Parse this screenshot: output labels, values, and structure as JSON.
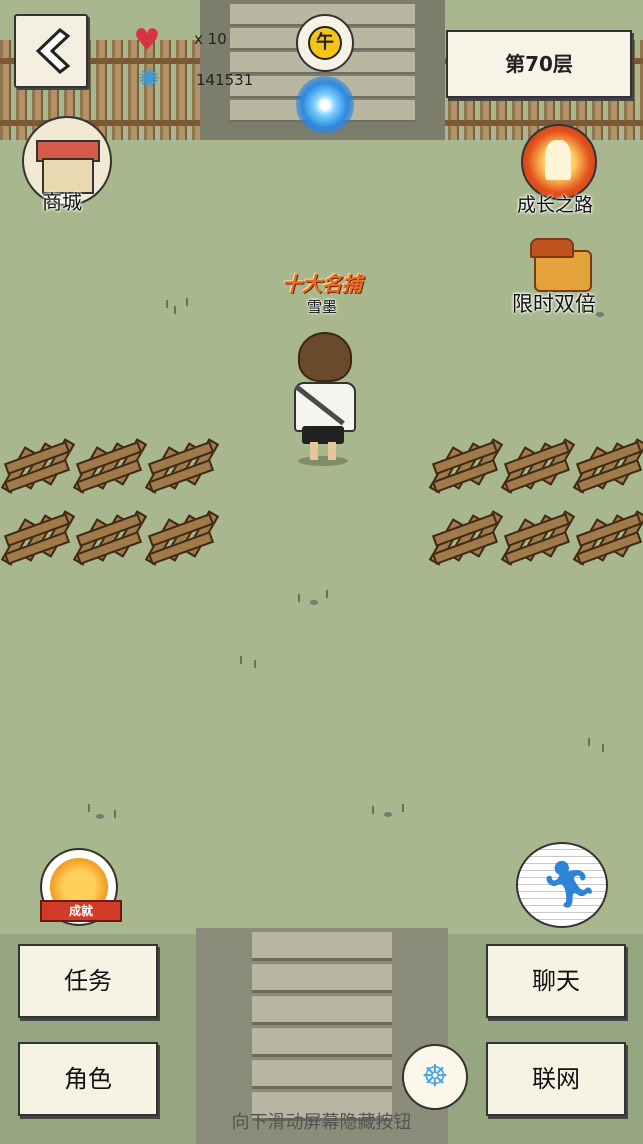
{
  "hud": {
    "lives": "x 10",
    "stamina": "141531",
    "time_glyph": "午",
    "floor": "第70层"
  },
  "icons": {
    "back": "chevron-left-icon",
    "heart": "heart-icon",
    "stamina": "swirl-icon",
    "time": "sun-icon",
    "portal": "portal-icon"
  },
  "features": {
    "shop": "商城",
    "growth": "成长之路",
    "double": "限时双倍",
    "achievement": "成就"
  },
  "player": {
    "title": "十大名捕",
    "name": "雪墨"
  },
  "menu": {
    "task": "任务",
    "chat": "聊天",
    "role": "角色",
    "network": "联网"
  },
  "hint": "向下滑动屏幕隐藏按钮",
  "colors": {
    "ground": "#a8b78e",
    "panel": "#f6f2e4",
    "heart": "#d9343d",
    "portal": "#2d89e0",
    "title": "#e86c24"
  }
}
